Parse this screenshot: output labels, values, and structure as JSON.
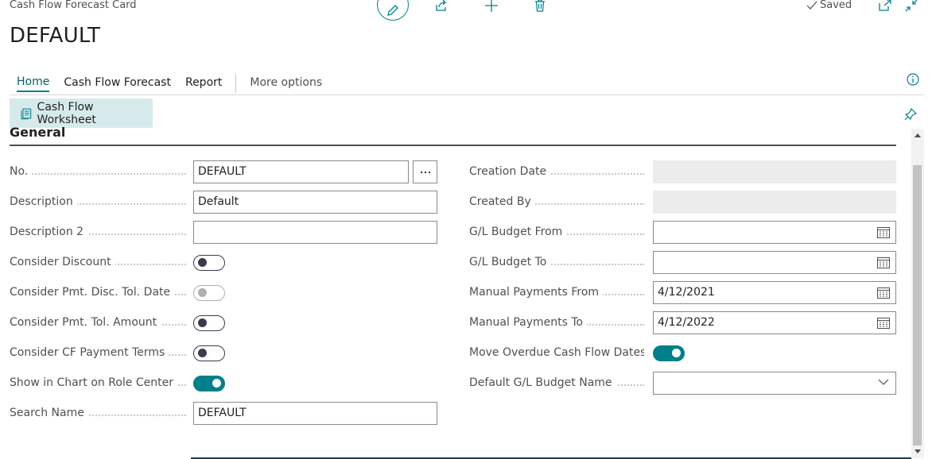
{
  "header": {
    "breadcrumb": "Cash Flow Forecast Card",
    "title": "DEFAULT",
    "saved_label": "Saved"
  },
  "tabs": [
    {
      "label": "Home",
      "active": true
    },
    {
      "label": "Cash Flow Forecast"
    },
    {
      "label": "Report"
    },
    {
      "label": "More options"
    }
  ],
  "actions": {
    "cash_flow_worksheet": "Cash Flow Worksheet"
  },
  "section": {
    "title": "General"
  },
  "left_fields": [
    {
      "label": "No.",
      "type": "text",
      "value": "DEFAULT"
    },
    {
      "label": "Description",
      "type": "text",
      "value": "Default"
    },
    {
      "label": "Description 2",
      "type": "text",
      "value": ""
    },
    {
      "label": "Consider Discount",
      "type": "toggle",
      "value": false
    },
    {
      "label": "Consider Pmt. Disc. Tol. Date",
      "type": "toggle",
      "value": false,
      "disabled": true
    },
    {
      "label": "Consider Pmt. Tol. Amount",
      "type": "toggle",
      "value": false
    },
    {
      "label": "Consider CF Payment Terms",
      "type": "toggle",
      "value": false
    },
    {
      "label": "Show in Chart on Role Center",
      "type": "toggle",
      "value": true
    },
    {
      "label": "Search Name",
      "type": "text",
      "value": "DEFAULT"
    }
  ],
  "right_fields": [
    {
      "label": "Creation Date",
      "type": "readonly",
      "value": ""
    },
    {
      "label": "Created By",
      "type": "readonly",
      "value": ""
    },
    {
      "label": "G/L Budget From",
      "type": "date",
      "value": ""
    },
    {
      "label": "G/L Budget To",
      "type": "date",
      "value": ""
    },
    {
      "label": "Manual Payments From",
      "type": "date",
      "value": "4/12/2021"
    },
    {
      "label": "Manual Payments To",
      "type": "date",
      "value": "4/12/2022"
    },
    {
      "label": "Move Overdue Cash Flow Dates...",
      "type": "toggle",
      "value": true
    },
    {
      "label": "Default G/L Budget Name",
      "type": "select",
      "value": ""
    }
  ],
  "colors": {
    "accent": "#00808a",
    "action_bg": "#d6eaeb"
  }
}
